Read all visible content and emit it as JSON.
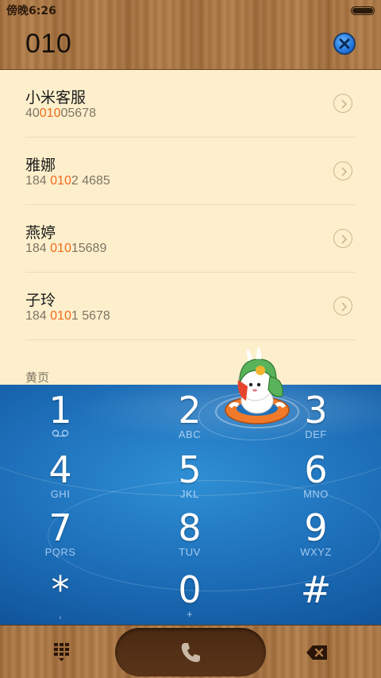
{
  "status_bar": {
    "time": "傍晚6:26"
  },
  "header": {
    "dialed_number": "010"
  },
  "contacts": [
    {
      "name": "小米客服",
      "number_before": "40",
      "number_match": "010",
      "number_after": "05678"
    },
    {
      "name": "雅娜",
      "number_before": "184 ",
      "number_match": "010",
      "number_after": "2 4685"
    },
    {
      "name": "燕婷",
      "number_before": "184 ",
      "number_match": "010",
      "number_after": "15689"
    },
    {
      "name": "子玲",
      "number_before": "184 ",
      "number_match": "010",
      "number_after": "1 5678"
    }
  ],
  "section_label": "黄页",
  "keypad": {
    "keys": [
      {
        "digit": "1",
        "letters": ""
      },
      {
        "digit": "2",
        "letters": "ABC"
      },
      {
        "digit": "3",
        "letters": "DEF"
      },
      {
        "digit": "4",
        "letters": "GHI"
      },
      {
        "digit": "5",
        "letters": "JKL"
      },
      {
        "digit": "6",
        "letters": "MNO"
      },
      {
        "digit": "7",
        "letters": "PQRS"
      },
      {
        "digit": "8",
        "letters": "TUV"
      },
      {
        "digit": "9",
        "letters": "WXYZ"
      },
      {
        "digit": "*",
        "letters": ","
      },
      {
        "digit": "0",
        "letters": "+"
      },
      {
        "digit": "#",
        "letters": ""
      }
    ]
  },
  "icons": {
    "clear": "close-icon",
    "contact_detail": "chevron-right-icon",
    "voicemail": "voicemail-icon",
    "dialpad": "dialpad-icon",
    "call": "phone-icon",
    "delete": "backspace-icon",
    "mascot": "mitu-mascot-icon"
  },
  "colors": {
    "highlight": "#f26b1d",
    "keypad_blue": "#1d6fb9",
    "list_bg": "#fdefcc"
  }
}
